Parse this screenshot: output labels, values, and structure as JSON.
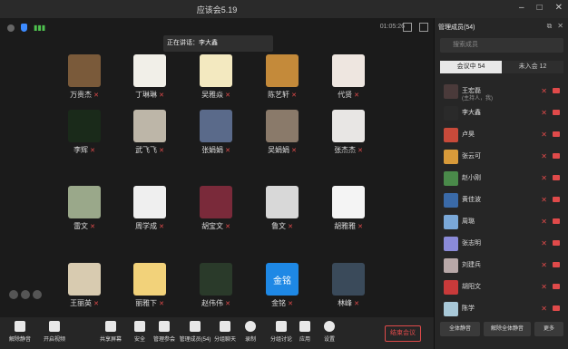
{
  "window": {
    "title": "应该会5.19"
  },
  "stage": {
    "timer": "01:05:26",
    "speaking": "正在讲话：李大鑫",
    "cells": [
      {
        "name": "万贵杰",
        "color": "#7a5a3a"
      },
      {
        "name": "丁琳琳",
        "color": "#f1efe8"
      },
      {
        "name": "吴雅焱",
        "color": "#f3e9c0"
      },
      {
        "name": "陈艺轩",
        "color": "#c48a3a"
      },
      {
        "name": "代贤",
        "color": "#eee6e0"
      },
      {
        "name": "李辉",
        "color": "#1a2a1a"
      },
      {
        "name": "武飞飞",
        "color": "#bdb6a8"
      },
      {
        "name": "张娟娟",
        "color": "#5a6a8a"
      },
      {
        "name": "吴娟娟",
        "color": "#8a7a6a"
      },
      {
        "name": "张杰杰",
        "color": "#e8e6e4"
      },
      {
        "name": "雷文",
        "color": "#9aa88a"
      },
      {
        "name": "周学成",
        "color": "#efefef"
      },
      {
        "name": "胡宝文",
        "color": "#7a2a3a"
      },
      {
        "name": "鲁文",
        "color": "#d8d8d8"
      },
      {
        "name": "胡雅雅",
        "color": "#f4f4f4"
      },
      {
        "name": "王丽英",
        "color": "#d8cbb0"
      },
      {
        "name": "丽雅下",
        "color": "#f2d27a"
      },
      {
        "name": "赵伟伟",
        "color": "#2a3a2a"
      },
      {
        "name": "金铭",
        "color": "#1e88e5",
        "text": "金铭"
      },
      {
        "name": "林峰",
        "color": "#3a4a5a"
      }
    ]
  },
  "toolbar": {
    "mute": "解除静音",
    "video": "开启视频",
    "share": "共享屏幕",
    "security": "安全",
    "manage": "管理参会",
    "members": "管理成员(54)",
    "chat": "分组聊天",
    "record": "录制",
    "breakout": "分组讨论",
    "apps": "应用",
    "settings": "设置",
    "end": "结束会议"
  },
  "panel": {
    "title": "管理成员(54)",
    "search_placeholder": "搜索成员",
    "tabs": [
      "会议中 54",
      "未入会 12"
    ],
    "members": [
      {
        "name": "王宏磊",
        "sub": "(主持人，我)",
        "color": "#4a3a3a"
      },
      {
        "name": "李大鑫",
        "sub": "",
        "color": "#2a2a2a"
      },
      {
        "name": "卢昊",
        "sub": "",
        "color": "#c84a3a"
      },
      {
        "name": "张云可",
        "sub": "",
        "color": "#d89a3a"
      },
      {
        "name": "赵小刚",
        "sub": "",
        "color": "#4a8a4a"
      },
      {
        "name": "黄佳波",
        "sub": "",
        "color": "#3a6aa8"
      },
      {
        "name": "周璐",
        "sub": "",
        "color": "#7aa8d8"
      },
      {
        "name": "张志明",
        "sub": "",
        "color": "#8a8ad8"
      },
      {
        "name": "刘建兵",
        "sub": "",
        "color": "#b8a8a8"
      },
      {
        "name": "胡阳文",
        "sub": "",
        "color": "#c83a3a"
      },
      {
        "name": "陈学",
        "sub": "",
        "color": "#a8c8d8"
      }
    ],
    "buttons": [
      "全体静音",
      "解除全体静音",
      "更多"
    ]
  }
}
